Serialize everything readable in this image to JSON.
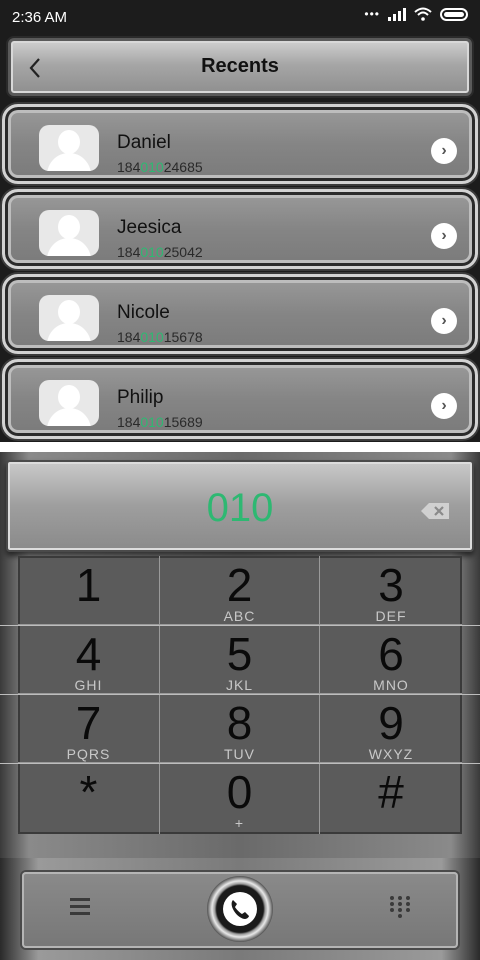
{
  "status_bar": {
    "time": "2:36 AM"
  },
  "header": {
    "title": "Recents"
  },
  "contacts": [
    {
      "name": "Daniel",
      "number_prefix": "184",
      "number_match": "010",
      "number_suffix": "24685"
    },
    {
      "name": "Jeesica",
      "number_prefix": "184",
      "number_match": "010",
      "number_suffix": "25042"
    },
    {
      "name": "Nicole",
      "number_prefix": "184",
      "number_match": "010",
      "number_suffix": "15678"
    },
    {
      "name": "Philip",
      "number_prefix": "184",
      "number_match": "010",
      "number_suffix": "15689"
    }
  ],
  "dialer": {
    "input_value": "010",
    "accent_color": "#2eb872"
  },
  "keypad": [
    {
      "digit": "1",
      "letters": ""
    },
    {
      "digit": "2",
      "letters": "ABC"
    },
    {
      "digit": "3",
      "letters": "DEF"
    },
    {
      "digit": "4",
      "letters": "GHI"
    },
    {
      "digit": "5",
      "letters": "JKL"
    },
    {
      "digit": "6",
      "letters": "MNO"
    },
    {
      "digit": "7",
      "letters": "PQRS"
    },
    {
      "digit": "8",
      "letters": "TUV"
    },
    {
      "digit": "9",
      "letters": "WXYZ"
    },
    {
      "digit": "*",
      "letters": ""
    },
    {
      "digit": "0",
      "letters": "+"
    },
    {
      "digit": "#",
      "letters": ""
    }
  ],
  "bottom_bar": {
    "menu_icon": "menu-icon",
    "call_icon": "phone-icon",
    "keypad_icon": "dialpad-icon"
  }
}
